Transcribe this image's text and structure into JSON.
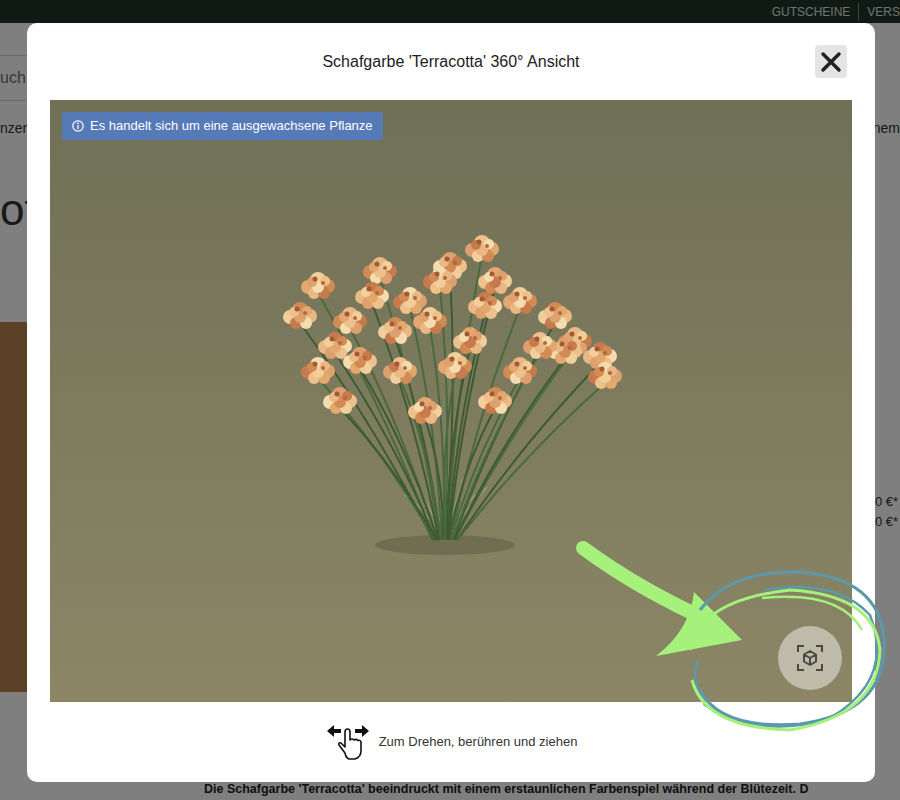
{
  "topbar": {
    "links": [
      {
        "label": "GUTSCHEINE"
      },
      {
        "label": "VERS"
      }
    ]
  },
  "page": {
    "search_text": "uch",
    "nav_left": "nzer",
    "nav_right": "nem",
    "heading": "ot",
    "prices": [
      "0 €*",
      "0 €*"
    ],
    "description": "Die Schafgarbe 'Terracotta' beeindruckt mit einem erstaunlichen Farbenspiel während der Blütezeit. D"
  },
  "dialog": {
    "title": "Schafgarbe 'Terracotta' 360° Ansicht",
    "badge": "Es handelt sich um eine ausgewachsene Pflanze",
    "hint": "Zum Drehen, berühren und ziehen"
  }
}
